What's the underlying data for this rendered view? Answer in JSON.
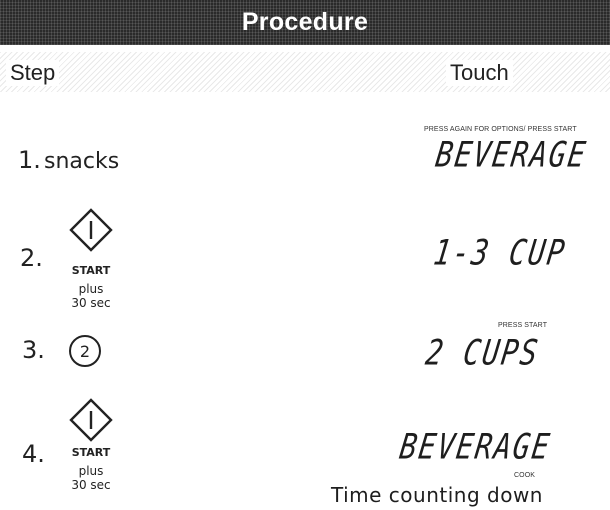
{
  "header": {
    "title": "Procedure"
  },
  "columns": {
    "step": "Step",
    "touch": "Touch"
  },
  "steps": [
    {
      "number": "1.",
      "text": "snacks",
      "display": {
        "top_label": "PRESS AGAIN FOR OPTIONS/  PRESS START",
        "lcd": "BEVERAGE"
      }
    },
    {
      "number": "2.",
      "button": {
        "icon": "start-icon",
        "label": "START"
      },
      "plus": "plus",
      "time": "30 sec",
      "display": {
        "lcd": "1-3 CUP"
      }
    },
    {
      "number": "3.",
      "pad_key": "2",
      "display": {
        "top_label": "PRESS START",
        "lcd": "2 CUPS"
      }
    },
    {
      "number": "4.",
      "button": {
        "icon": "start-icon",
        "label": "START"
      },
      "plus": "plus",
      "time": "30 sec",
      "display": {
        "lcd": "BEVERAGE",
        "bottom_label": "COOK",
        "caption": "Time counting down"
      }
    }
  ]
}
